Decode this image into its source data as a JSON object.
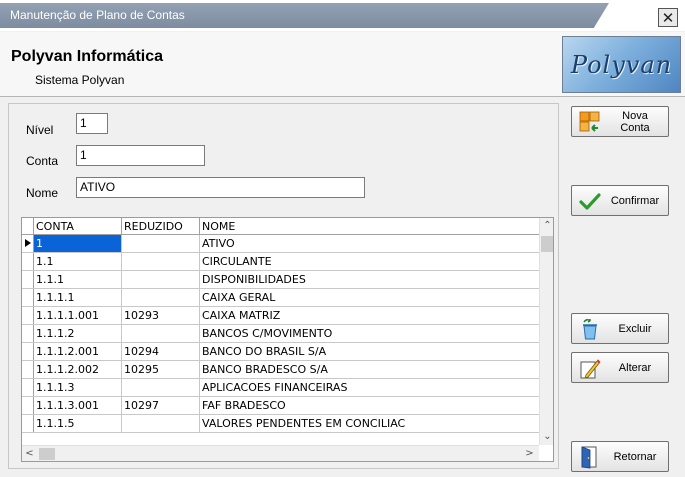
{
  "window": {
    "title": "Manutenção de Plano de Contas",
    "close_symbol": "✕"
  },
  "header": {
    "company": "Polyvan Informática",
    "system": "Sistema Polyvan",
    "logo_text": "Polyvan"
  },
  "form": {
    "nivel_label": "Nível",
    "nivel_value": "1",
    "conta_label": "Conta",
    "conta_value": "1",
    "nome_label": "Nome",
    "nome_value": "ATIVO"
  },
  "grid": {
    "columns": [
      "CONTA",
      "REDUZIDO",
      "NOME"
    ],
    "rows": [
      {
        "conta": "1",
        "reduzido": "",
        "nome": "ATIVO"
      },
      {
        "conta": "1.1",
        "reduzido": "",
        "nome": "CIRCULANTE"
      },
      {
        "conta": "1.1.1",
        "reduzido": "",
        "nome": "DISPONIBILIDADES"
      },
      {
        "conta": "1.1.1.1",
        "reduzido": "",
        "nome": "CAIXA GERAL"
      },
      {
        "conta": "1.1.1.1.001",
        "reduzido": "10293",
        "nome": "CAIXA MATRIZ"
      },
      {
        "conta": "1.1.1.2",
        "reduzido": "",
        "nome": "BANCOS C/MOVIMENTO"
      },
      {
        "conta": "1.1.1.2.001",
        "reduzido": "10294",
        "nome": "BANCO DO BRASIL S/A"
      },
      {
        "conta": "1.1.1.2.002",
        "reduzido": "10295",
        "nome": "BANCO BRADESCO S/A"
      },
      {
        "conta": "1.1.1.3",
        "reduzido": "",
        "nome": "APLICACOES FINANCEIRAS"
      },
      {
        "conta": "1.1.1.3.001",
        "reduzido": "10297",
        "nome": "FAF BRADESCO"
      },
      {
        "conta": "1.1.1.5",
        "reduzido": "",
        "nome": "VALORES PENDENTES EM CONCILIAC"
      }
    ],
    "selected_row": 0
  },
  "buttons": {
    "nova_conta": "Nova Conta",
    "confirmar": "Confirmar",
    "excluir": "Excluir",
    "alterar": "Alterar",
    "retornar": "Retornar"
  },
  "colors": {
    "selection": "#0a64d8",
    "title_bar": "#8796aa"
  }
}
